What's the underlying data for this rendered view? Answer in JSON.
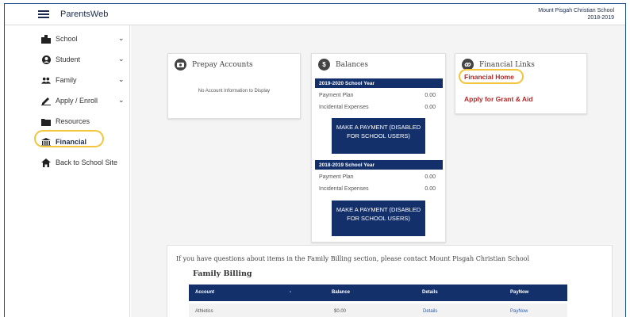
{
  "header": {
    "app_title": "ParentsWeb",
    "school_name": "Mount Pisgah Christian School",
    "school_year": "2018-2019"
  },
  "sidebar": {
    "items": [
      {
        "label": "School",
        "icon": "school-icon",
        "has_chevron": true
      },
      {
        "label": "Student",
        "icon": "student-icon",
        "has_chevron": true
      },
      {
        "label": "Family",
        "icon": "family-icon",
        "has_chevron": true
      },
      {
        "label": "Apply / Enroll",
        "icon": "pencil-icon",
        "has_chevron": true
      },
      {
        "label": "Resources",
        "icon": "folder-icon",
        "has_chevron": false
      },
      {
        "label": "Financial",
        "icon": "bank-icon",
        "has_chevron": false,
        "active": true
      },
      {
        "label": "Back to School Site",
        "icon": "home-icon",
        "has_chevron": false
      }
    ]
  },
  "prepay": {
    "title": "Prepay Accounts",
    "empty_text": "No Account Information to Display"
  },
  "balances": {
    "title": "Balances",
    "years": [
      {
        "label": "2019-2020 School Year",
        "rows": [
          {
            "label": "Payment Plan",
            "value": "0.00"
          },
          {
            "label": "Incidental Expenses",
            "value": "0.00"
          }
        ],
        "button": "MAKE A PAYMENT (DISABLED FOR SCHOOL USERS)"
      },
      {
        "label": "2018-2019 School Year",
        "rows": [
          {
            "label": "Payment Plan",
            "value": "0.00"
          },
          {
            "label": "Incidental Expenses",
            "value": "0.00"
          }
        ],
        "button": "MAKE A PAYMENT (DISABLED FOR SCHOOL USERS)"
      }
    ]
  },
  "financial_links": {
    "title": "Financial Links",
    "links": [
      "Financial Home",
      "Apply for Grant & Aid"
    ]
  },
  "billing": {
    "note": "If you have questions about items in the Family Billing section, please contact Mount Pisgah Christian School",
    "title": "Family Billing",
    "columns": [
      "Account",
      "-",
      "Balance",
      "Details",
      "PayNow"
    ],
    "rows": [
      {
        "account": "Athletics",
        "balance": "$0.00",
        "details": "Details",
        "paynow": "PayNow"
      }
    ]
  },
  "colors": {
    "navy": "#13306b",
    "link_red": "#b22a2a",
    "highlight": "#f2c53a"
  }
}
